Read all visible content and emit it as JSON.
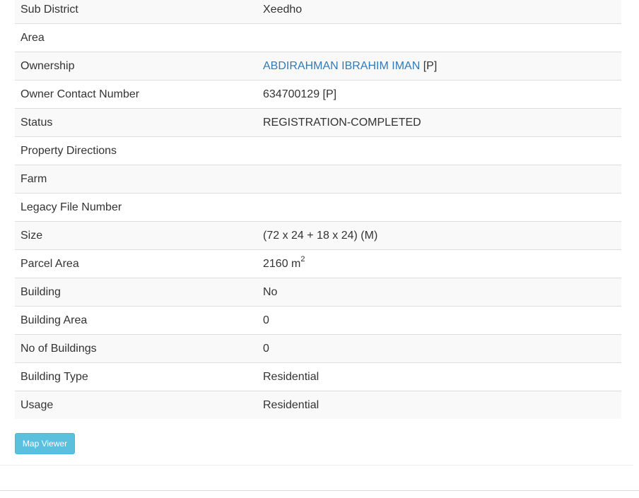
{
  "details": {
    "rows": [
      {
        "label": "Sub District",
        "value": "Xeedho"
      },
      {
        "label": "Area",
        "value": ""
      },
      {
        "label": "Ownership",
        "owner_name": "ABDIRAHMAN IBRAHIM IMAN",
        "owner_suffix": " [P]"
      },
      {
        "label": "Owner Contact Number",
        "value": "634700129 [P]"
      },
      {
        "label": "Status",
        "value": "REGISTRATION-COMPLETED"
      },
      {
        "label": "Property Directions",
        "value": ""
      },
      {
        "label": "Farm",
        "value": ""
      },
      {
        "label": "Legacy File Number",
        "value": ""
      },
      {
        "label": "Size",
        "value": "(72 x 24 + 18 x 24) (M)"
      },
      {
        "label": "Parcel Area",
        "value": "2160 m",
        "value_sup": "2"
      },
      {
        "label": "Building",
        "value": "No"
      },
      {
        "label": "Building Area",
        "value": "0"
      },
      {
        "label": "No of Buildings",
        "value": "0"
      },
      {
        "label": "Building Type",
        "value": "Residential"
      },
      {
        "label": "Usage",
        "value": "Residential"
      }
    ]
  },
  "actions": {
    "map_viewer_label": "Map Viewer"
  },
  "colors": {
    "link": "#337ab7",
    "info_button": "#5bc0de",
    "stripe": "#f9f9f9"
  }
}
